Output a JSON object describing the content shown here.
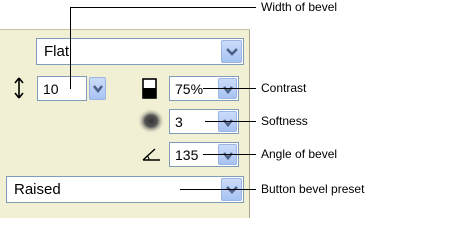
{
  "panel": {
    "bevel_style": {
      "value": "Flat",
      "icon": "chevron-down-icon"
    },
    "bevel_width": {
      "value": "10",
      "icon": "up-down-arrow-icon"
    },
    "contrast": {
      "value": "75%",
      "icon": "contrast-icon"
    },
    "softness": {
      "value": "3",
      "icon": "softness-blur-icon"
    },
    "angle": {
      "value": "135",
      "icon": "angle-icon"
    },
    "preset": {
      "value": "Raised"
    }
  },
  "callouts": {
    "width_of_bevel": "Width of bevel",
    "contrast": "Contrast",
    "softness": "Softness",
    "angle_of_bevel": "Angle of bevel",
    "button_bevel_preset": "Button bevel preset"
  },
  "colors": {
    "panel_bg": "#f2f0d4",
    "field_border": "#7f9db9",
    "dropdown_button": "#b8cff5",
    "chevron": "#4d6185"
  }
}
